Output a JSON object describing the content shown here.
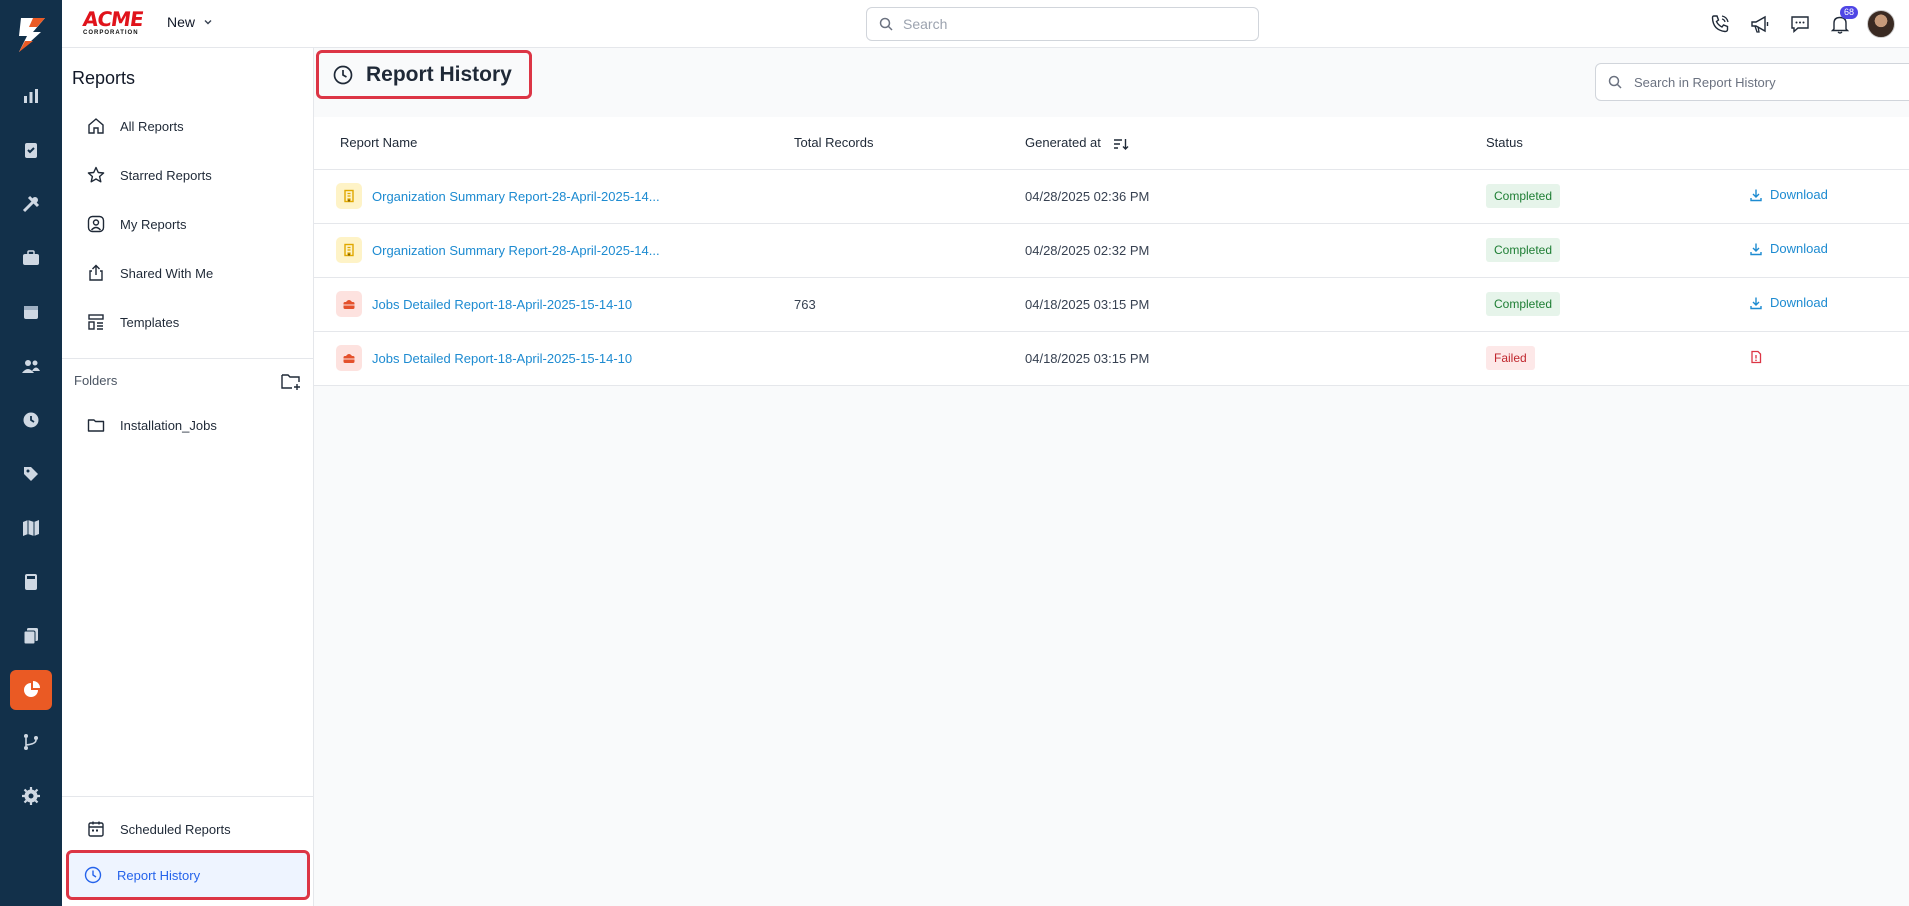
{
  "brand": {
    "name": "ACME",
    "tagline": "CORPORATION"
  },
  "topbar": {
    "new_label": "New",
    "search_placeholder": "Search",
    "notifications_count": "68"
  },
  "rail": {
    "items": [
      "dashboard-icon",
      "clipboard-icon",
      "tools-icon",
      "briefcase-icon",
      "calendar-icon",
      "users-icon",
      "clock-icon",
      "tag-icon",
      "map-icon",
      "calculator-icon",
      "documents-icon",
      "reports-icon",
      "workflow-icon",
      "settings-icon"
    ],
    "active": "reports-icon",
    "active_color": "#ea5a24",
    "bg_color": "#12304a"
  },
  "sidebar": {
    "title": "Reports",
    "items": [
      {
        "label": "All Reports",
        "icon": "home-icon"
      },
      {
        "label": "Starred Reports",
        "icon": "star-icon"
      },
      {
        "label": "My Reports",
        "icon": "user-circle-icon"
      },
      {
        "label": "Shared With Me",
        "icon": "share-icon"
      },
      {
        "label": "Templates",
        "icon": "template-icon"
      }
    ],
    "folders_label": "Folders",
    "folders": [
      {
        "label": "Installation_Jobs",
        "icon": "folder-icon"
      }
    ],
    "bottom_items": [
      {
        "label": "Scheduled Reports",
        "icon": "calendar-icon"
      },
      {
        "label": "Report History",
        "icon": "clock-icon",
        "active": true
      }
    ]
  },
  "main": {
    "title": "Report History",
    "search_placeholder": "Search in Report History",
    "columns": [
      "Report Name",
      "Total Records",
      "Generated at",
      "Status"
    ],
    "rows": [
      {
        "name": "Organization Summary Report-28-April-2025-14...",
        "type": "org",
        "records": "",
        "generated": "04/28/2025 02:36 PM",
        "status": "Completed",
        "action": "Download"
      },
      {
        "name": "Organization Summary Report-28-April-2025-14...",
        "type": "org",
        "records": "",
        "generated": "04/28/2025 02:32 PM",
        "status": "Completed",
        "action": "Download"
      },
      {
        "name": "Jobs Detailed Report-18-April-2025-15-14-10",
        "type": "job",
        "records": "763",
        "generated": "04/18/2025 03:15 PM",
        "status": "Completed",
        "action": "Download"
      },
      {
        "name": "Jobs Detailed Report-18-April-2025-15-14-10",
        "type": "job",
        "records": "",
        "generated": "04/18/2025 03:15 PM",
        "status": "Failed",
        "action": ""
      }
    ]
  },
  "colors": {
    "link": "#1d8bd1",
    "highlight": "#dc3545",
    "completed_bg": "#e6f4ea",
    "failed_bg": "#fde8e8"
  }
}
